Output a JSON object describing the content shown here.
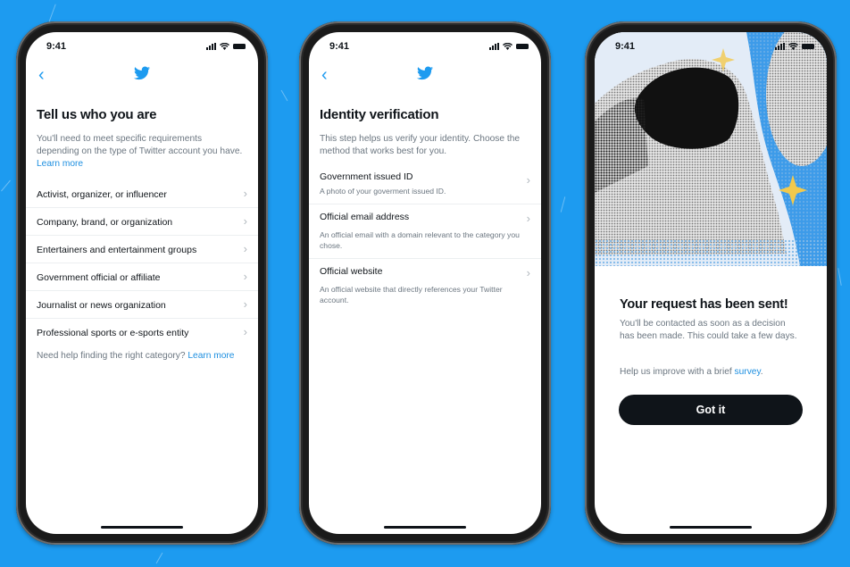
{
  "status_bar": {
    "time": "9:41"
  },
  "screens": [
    {
      "title": "Tell us who you are",
      "description": "You'll need to meet specific requirements depending on the type of Twitter account you have.",
      "description_link": "Learn more",
      "options": [
        "Activist, organizer, or influencer",
        "Company, brand, or organization",
        "Entertainers and entertainment groups",
        "Government official or affiliate",
        "Journalist or news organization",
        "Professional sports or e-sports entity"
      ],
      "footer_text": "Need help finding the right category?",
      "footer_link": "Learn more"
    },
    {
      "title": "Identity verification",
      "description": "This step helps us verify your identity. Choose the method that works best for you.",
      "methods": [
        {
          "title": "Government issued ID",
          "subtitle": "A photo of your goverment issued ID."
        },
        {
          "title": "Official email address",
          "subtitle": "An official email with a domain relevant to the category you chose."
        },
        {
          "title": "Official website",
          "subtitle": "An official website that directly references your Twitter account."
        }
      ]
    },
    {
      "title": "Your request has been sent!",
      "description": "You'll be contacted as soon as a decision has been made. This could take a few days.",
      "survey_text": "Help us improve with a brief",
      "survey_link": "survey",
      "survey_suffix": ".",
      "button_label": "Got it",
      "illustration": "astronaut-halftone-illustration"
    }
  ],
  "colors": {
    "background": "#1d9bf0",
    "accent": "#1d9bf0",
    "button": "#0f1419"
  }
}
